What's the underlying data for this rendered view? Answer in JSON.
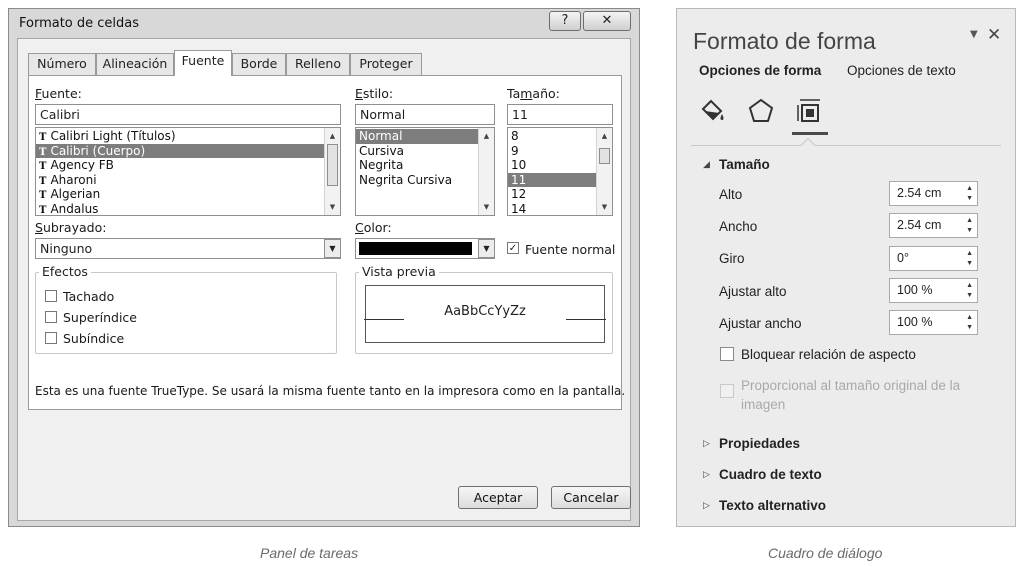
{
  "dialog": {
    "title": "Formato de celdas",
    "help_label": "?",
    "close_label": "✕",
    "tabs": [
      "Número",
      "Alineación",
      "Fuente",
      "Borde",
      "Relleno",
      "Proteger"
    ],
    "font": {
      "label": "Fuente:",
      "value": "Calibri",
      "items": [
        "Calibri Light (Títulos)",
        "Calibri (Cuerpo)",
        "Agency FB",
        "Aharoni",
        "Algerian",
        "Andalus"
      ],
      "selected_index": 1
    },
    "style": {
      "label": "Estilo:",
      "value": "Normal",
      "items": [
        "Normal",
        "Cursiva",
        "Negrita",
        "Negrita Cursiva"
      ],
      "selected_index": 0
    },
    "size": {
      "label": "Tamaño:",
      "value": "11",
      "items": [
        "8",
        "9",
        "10",
        "11",
        "12",
        "14"
      ],
      "selected_index": 3
    },
    "underline": {
      "label": "Subrayado:",
      "value": "Ninguno"
    },
    "color": {
      "label": "Color:",
      "swatch": "#000000"
    },
    "normal_font": {
      "label": "Fuente normal",
      "checked": true
    },
    "effects": {
      "legend": "Efectos",
      "items": [
        "Tachado",
        "Superíndice",
        "Subíndice"
      ]
    },
    "preview": {
      "legend": "Vista previa",
      "sample": "AaBbCcYyZz"
    },
    "info_text": "Esta es una fuente TrueType. Se usará la misma fuente tanto en la impresora como en la pantalla.",
    "ok_label": "Aceptar",
    "cancel_label": "Cancelar"
  },
  "pane": {
    "title": "Formato de forma",
    "dropdown_icon": "▼",
    "close_label": "✕",
    "tabs": [
      "Opciones de forma",
      "Opciones de texto"
    ],
    "icons": [
      "fill-line-icon",
      "effects-pentagon-icon",
      "size-properties-icon"
    ],
    "section_size": "Tamaño",
    "rows": [
      {
        "label": "Alto",
        "value": "2.54 cm"
      },
      {
        "label": "Ancho",
        "value": "2.54 cm"
      },
      {
        "label": "Giro",
        "value": "0°"
      },
      {
        "label": "Ajustar alto",
        "value": "100 %"
      },
      {
        "label": "Ajustar ancho",
        "value": "100 %"
      }
    ],
    "lock_aspect": "Bloquear relación de aspecto",
    "relative_size": "Proporcional al tamaño original de la imagen",
    "sections": [
      "Propiedades",
      "Cuadro de texto",
      "Texto alternativo"
    ]
  },
  "captions": {
    "left": "Panel de tareas",
    "right": "Cuadro de diálogo"
  }
}
